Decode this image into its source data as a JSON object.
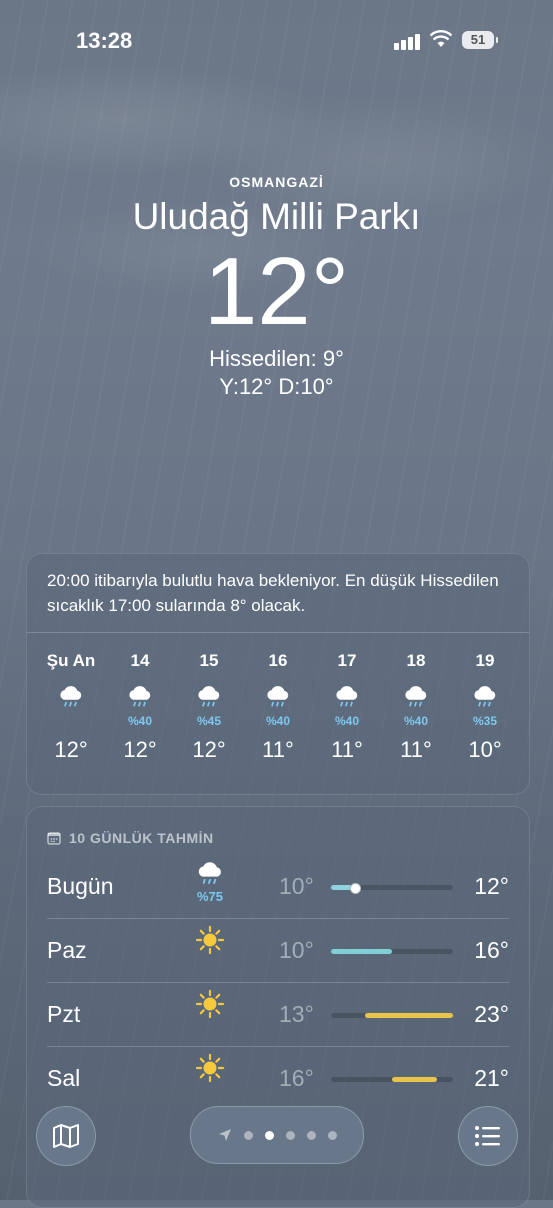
{
  "status": {
    "time": "13:28",
    "battery": "51"
  },
  "location": {
    "district": "OSMANGAZİ",
    "name": "Uludağ Milli Parkı"
  },
  "current": {
    "temp": "12°",
    "feels_like": "Hissedilen: 9°",
    "hilo": "Y:12° D:10°"
  },
  "hourly": {
    "summary": "20:00 itibarıyla bulutlu hava bekleniyor. En düşük Hissedilen sıcaklık 17:00 sularında 8° olacak.",
    "hours": [
      {
        "label": "Şu An",
        "icon": "cloud-rain-icon",
        "pct": "",
        "temp": "12°"
      },
      {
        "label": "14",
        "icon": "cloud-rain-icon",
        "pct": "%40",
        "temp": "12°"
      },
      {
        "label": "15",
        "icon": "cloud-rain-icon",
        "pct": "%45",
        "temp": "12°"
      },
      {
        "label": "16",
        "icon": "cloud-rain-icon",
        "pct": "%40",
        "temp": "11°"
      },
      {
        "label": "17",
        "icon": "cloud-rain-icon",
        "pct": "%40",
        "temp": "11°"
      },
      {
        "label": "18",
        "icon": "cloud-rain-icon",
        "pct": "%40",
        "temp": "11°"
      },
      {
        "label": "19",
        "icon": "cloud-rain-icon",
        "pct": "%35",
        "temp": "10°"
      }
    ]
  },
  "daily": {
    "title": "10 GÜNLÜK TAHMİN",
    "days": [
      {
        "day": "Bugün",
        "icon": "cloud-rain-icon",
        "pct": "%75",
        "lo": "10°",
        "hi": "12°",
        "range_start": 0.0,
        "range_end": 0.17,
        "color": "#8fd3e0",
        "current_dot": true
      },
      {
        "day": "Paz",
        "icon": "sun-icon",
        "pct": "",
        "lo": "10°",
        "hi": "16°",
        "range_start": 0.0,
        "range_end": 0.5,
        "color": "#7fd0d6"
      },
      {
        "day": "Pzt",
        "icon": "sun-icon",
        "pct": "",
        "lo": "13°",
        "hi": "23°",
        "range_start": 0.28,
        "range_end": 1.0,
        "color": "#e9c44a"
      },
      {
        "day": "Sal",
        "icon": "sun-icon",
        "pct": "",
        "lo": "16°",
        "hi": "21°",
        "range_start": 0.5,
        "range_end": 0.87,
        "color": "#e9c44a"
      }
    ]
  },
  "colors": {
    "rain_pct": "#7ec8f0",
    "sun": "#f7c83b"
  }
}
